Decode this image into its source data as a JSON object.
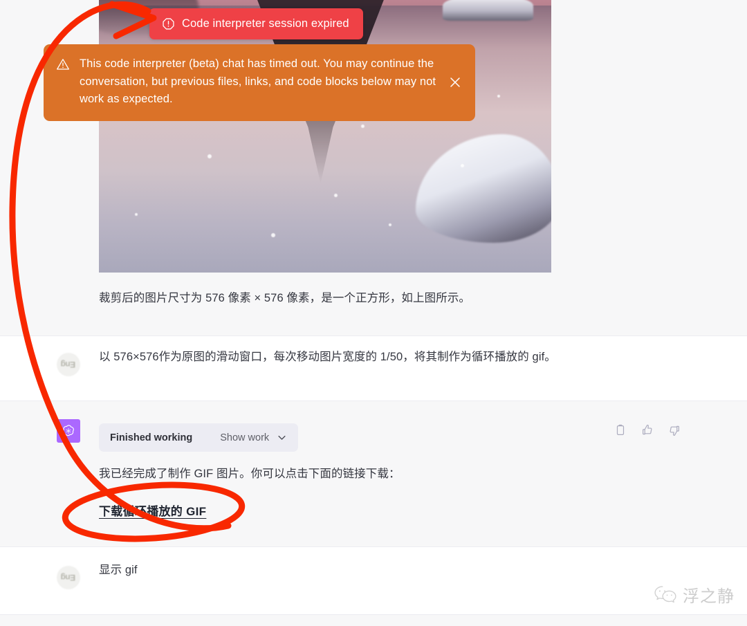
{
  "toast": {
    "icon": "alert-octagon-icon",
    "message": "Code interpreter session expired",
    "bg_color": "#ef4146"
  },
  "banner": {
    "icon": "warning-triangle-icon",
    "message": "This code interpreter (beta) chat has timed out. You may continue the conversation, but previous files, links, and code blocks below may not work as expected.",
    "close_icon": "close-icon",
    "bg_color": "#db7228"
  },
  "turns": [
    {
      "role": "assistant",
      "attachment_caption": "裁剪后的图片尺寸为 576 像素 × 576 像素，是一个正方形，如上图所示。"
    },
    {
      "role": "user",
      "avatar_glyph": "Eng",
      "text": "以 576×576作为原图的滑动窗口，每次移动图片宽度的 1/50，将其制作为循环播放的 gif。"
    },
    {
      "role": "assistant",
      "tool_pill": {
        "title": "Finished working",
        "show_label": "Show work",
        "chevron": "chevron-down-icon"
      },
      "text": "我已经完成了制作 GIF 图片。你可以点击下面的链接下载：",
      "link_label": "下载循环播放的 GIF",
      "actions": [
        {
          "name": "copy-icon",
          "label": "Copy"
        },
        {
          "name": "thumbs-up-icon",
          "label": "Good response"
        },
        {
          "name": "thumbs-down-icon",
          "label": "Bad response"
        }
      ]
    },
    {
      "role": "user",
      "avatar_glyph": "Eng",
      "text": "显示 gif"
    }
  ],
  "annotations": {
    "arrow_color": "#f82800",
    "arrow_target": "Code interpreter session expired",
    "ellipse_target": "下载循环播放的 GIF"
  },
  "watermark": {
    "icon": "wechat-icon",
    "text": "浮之静"
  },
  "colors": {
    "assistant_bg": "#f7f7f8",
    "user_bg": "#ffffff",
    "divider": "#ececf1",
    "assistant_avatar": "#ab68ff",
    "text": "#353740"
  }
}
